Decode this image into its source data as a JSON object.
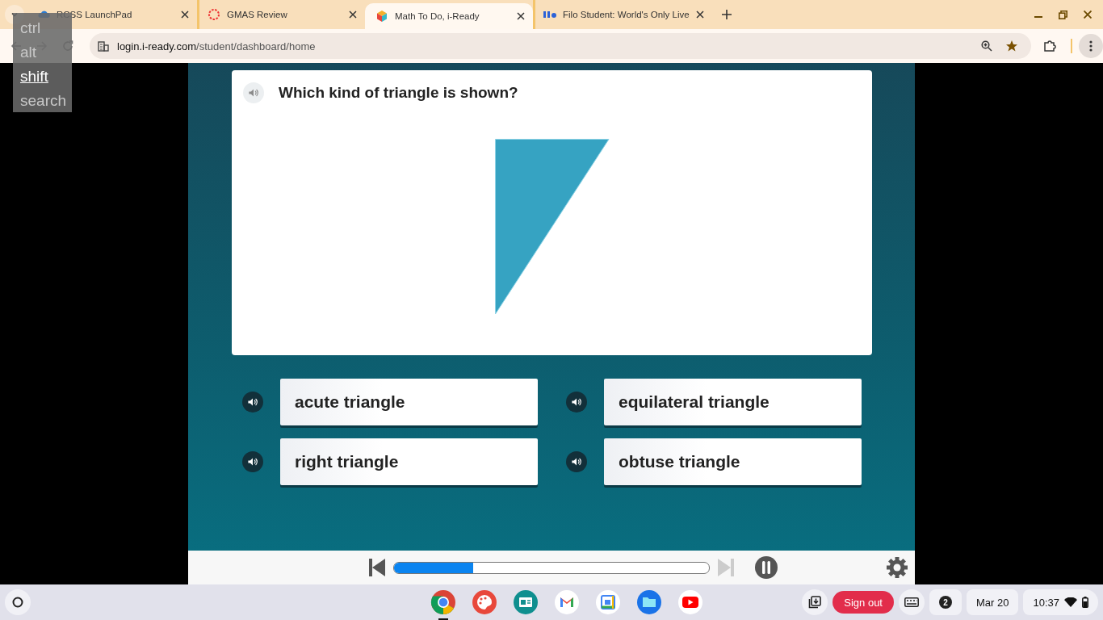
{
  "tabs": [
    {
      "kind": "cloud",
      "title": "RCSS LaunchPad",
      "selected": false
    },
    {
      "kind": "ring",
      "title": "GMAS Review",
      "selected": false
    },
    {
      "kind": "cube",
      "title": "Math To Do, i-Ready",
      "selected": true
    },
    {
      "kind": "filo",
      "title": "Filo Student: World's Only Live",
      "selected": false
    }
  ],
  "address_bar": {
    "host": "login.i-ready.com",
    "path": "/student/dashboard/home"
  },
  "modifier_keys": [
    {
      "label": "ctrl",
      "active": false
    },
    {
      "label": "alt",
      "active": false
    },
    {
      "label": "shift",
      "active": true
    },
    {
      "label": "search",
      "active": false
    }
  ],
  "question": {
    "text": "Which kind of triangle is shown?"
  },
  "answers": [
    {
      "text": "acute triangle"
    },
    {
      "text": "equilateral triangle"
    },
    {
      "text": "right triangle"
    },
    {
      "text": "obtuse triangle"
    }
  ],
  "player": {
    "level": 0.25
  },
  "shelf": {
    "apps": [
      {
        "kind": "chrome",
        "active": true
      },
      {
        "kind": "palette",
        "active": false
      },
      {
        "kind": "classroom",
        "active": false
      },
      {
        "kind": "mail",
        "active": false
      },
      {
        "kind": "calendar",
        "active": false
      },
      {
        "kind": "files",
        "active": false
      },
      {
        "kind": "video",
        "active": false
      }
    ],
    "sign_out": "Sign out",
    "notification_count": "2",
    "date": "Mar 20",
    "time": "10:37"
  }
}
